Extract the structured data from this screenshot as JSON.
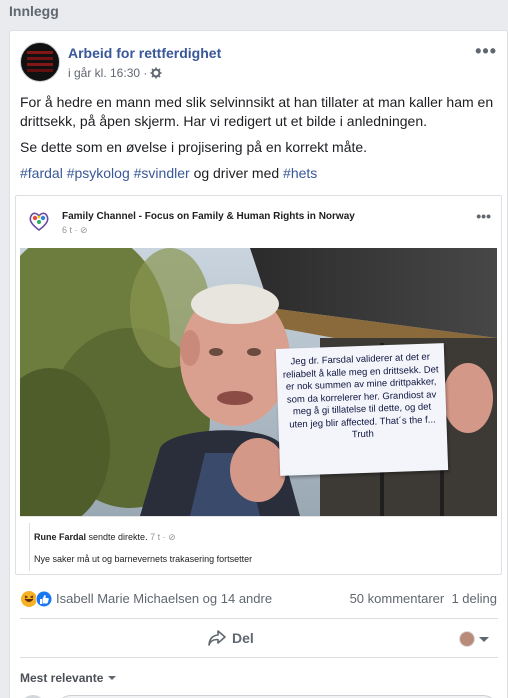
{
  "section_label": "Innlegg",
  "post": {
    "page_name": "Arbeid for rettferdighet",
    "timestamp": "i går kl. 16:30 ·",
    "text_p1": "For å hedre en mann med slik selvinnsikt at han tillater at man kaller ham en drittsekk, på åpen skjerm. Har vi redigert ut et bilde i anledningen.",
    "text_p2": "Se dette som en øvelse i projisering på en korrekt måte.",
    "hashtags": [
      "#fardal",
      "#psykolog",
      "#svindler"
    ],
    "hashtag_connector": "og driver med",
    "hashtag_last": "#hets"
  },
  "shared_post": {
    "page_name": "Family Channel - Focus on Family & Human Rights in Norway",
    "time": "6 t · ⊘",
    "sign_text": "Jeg dr. Farsdal validerer at det er reliabelt å kalle meg en drittsekk. Det er nok summen av mine drittpakker, som da korrelerer her. Grandiost av meg å gi tillatelse til dette, og det uten jeg blir affected. That´s the f... Truth",
    "footer_author": "Rune Fardal",
    "footer_action": "sendte direkte.",
    "footer_time": "7 t · ⊘",
    "footer_text": "Nye saker må ut og barnevernets trakasering fortsetter"
  },
  "reactions": {
    "names": "Isabell Marie Michaelsen og 14 andre",
    "comments": "50 kommentarer",
    "shares": "1 deling"
  },
  "actions": {
    "share_label": "Del"
  },
  "comments_sort": "Mest relevante",
  "colors": {
    "link_blue": "#385898",
    "background": "#e9ebee",
    "like_blue": "#1877f2",
    "haha_yellow": "#f7b125"
  }
}
